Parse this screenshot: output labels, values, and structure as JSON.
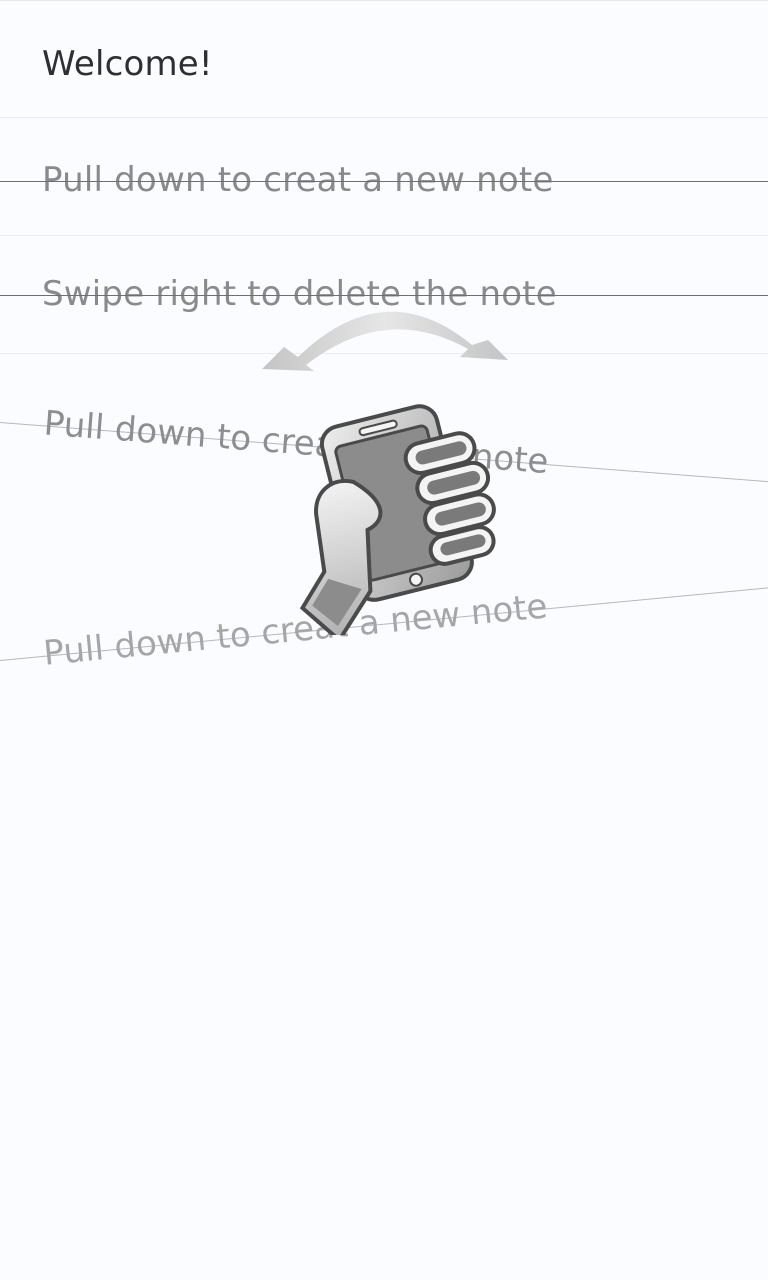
{
  "notes": [
    {
      "text": "Welcome!"
    },
    {
      "text": "Pull down to creat a new note"
    },
    {
      "text": "Swipe right to delete the note"
    }
  ],
  "animation_rows": [
    {
      "text": "Pull down to creat a new note"
    },
    {
      "text": "Pull down to creat a new note"
    }
  ],
  "colors": {
    "background": "#fbfcff",
    "primary_text": "#2f2f33",
    "secondary_text": "#8a8a8a",
    "divider": "#ececf0"
  },
  "icons": {
    "gesture": "hand-holding-phone-tilt-icon"
  }
}
